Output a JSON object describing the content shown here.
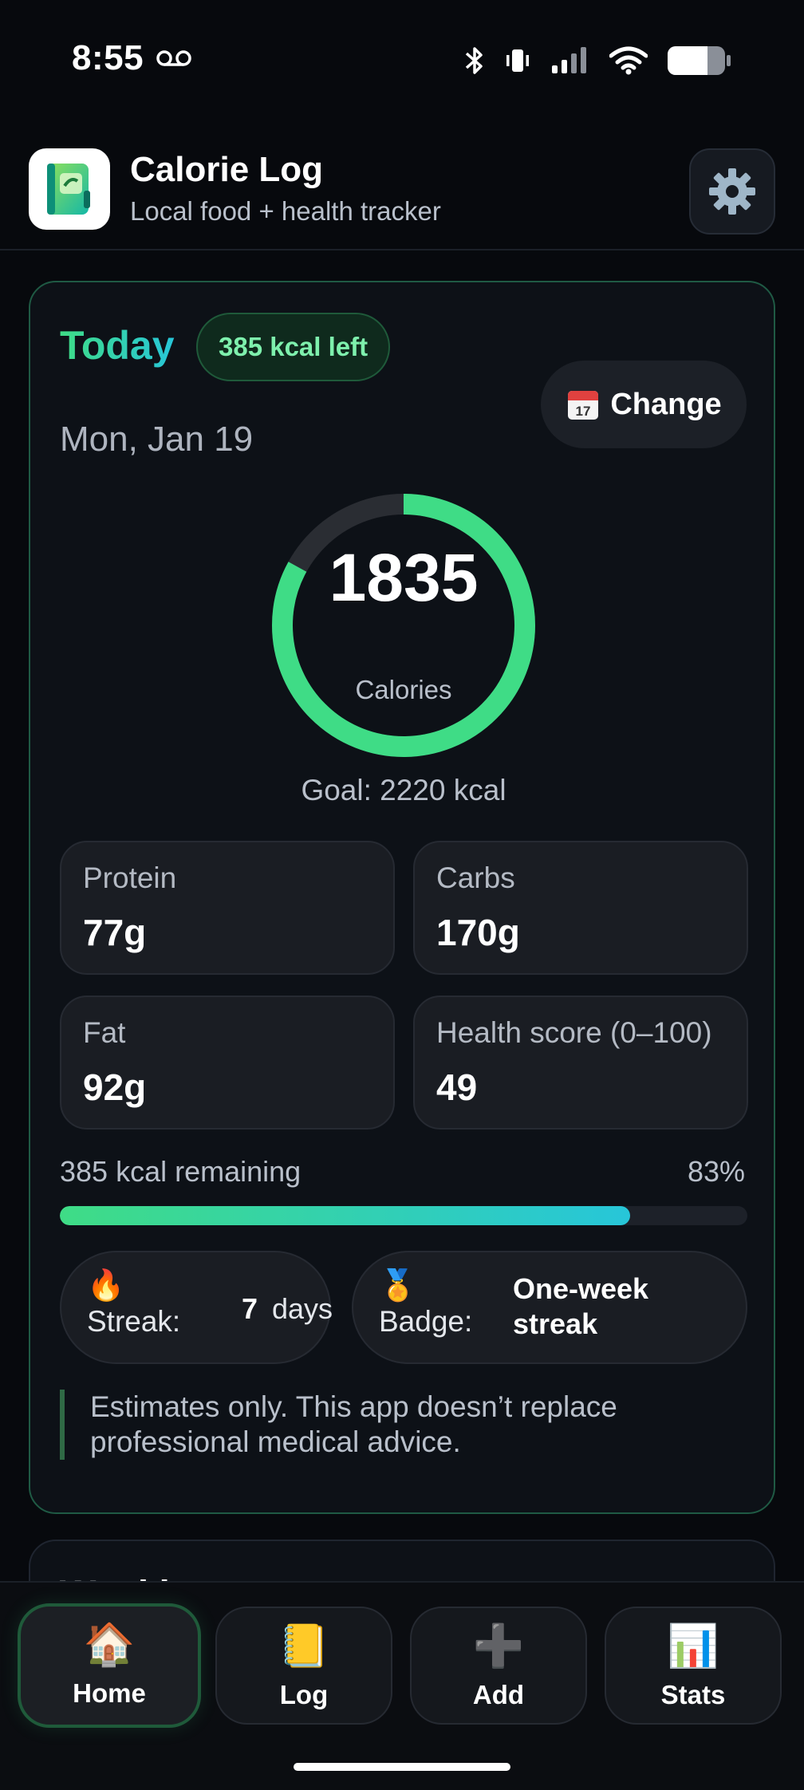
{
  "status_bar": {
    "time": "8:55",
    "icons": [
      "voicemail-icon",
      "bluetooth-icon",
      "vibrate-icon",
      "cellular-signal-icon",
      "wifi-icon",
      "battery-icon"
    ]
  },
  "app": {
    "title": "Calorie Log",
    "subtitle": "Local food + health tracker",
    "logo_icon": "green-notebook-icon",
    "settings_icon": "gear-icon"
  },
  "today": {
    "label": "Today",
    "kcal_left_badge": "385 kcal left",
    "change_button": {
      "icon": "calendar-icon",
      "label": "Change"
    },
    "date": "Mon, Jan 19",
    "calories": {
      "value": "1835",
      "label": "Calories",
      "progress": 0.83
    },
    "goal": "Goal: 2220 kcal",
    "stats": [
      {
        "label": "Protein",
        "value": "77g"
      },
      {
        "label": "Carbs",
        "value": "170g"
      },
      {
        "label": "Fat",
        "value": "92g"
      },
      {
        "label": "Health score (0–100)",
        "value": "49"
      }
    ],
    "remaining": "385 kcal remaining",
    "percent": "83%",
    "progress_fraction": 0.83,
    "streak": {
      "emoji": "🔥",
      "label": "Streak:",
      "value": "7",
      "unit": "days"
    },
    "badge": {
      "emoji": "🏅",
      "label": "Badge:",
      "value_line1": "One-week",
      "value_line2": "streak"
    },
    "disclaimer": "Estimates only. This app doesn’t replace professional medical advice."
  },
  "weekly": {
    "title": "Weekly"
  },
  "nav": {
    "items": [
      {
        "label": "Home",
        "icon": "🏠",
        "active": true
      },
      {
        "label": "Log",
        "icon": "📒",
        "active": false
      },
      {
        "label": "Add",
        "icon": "➕",
        "active": false
      },
      {
        "label": "Stats",
        "icon": "📊",
        "active": false
      }
    ]
  },
  "colors": {
    "accent_green": "#3fdc86",
    "accent_cyan": "#27c6d9",
    "card_border": "#1f5a44",
    "background": "#07090d"
  }
}
